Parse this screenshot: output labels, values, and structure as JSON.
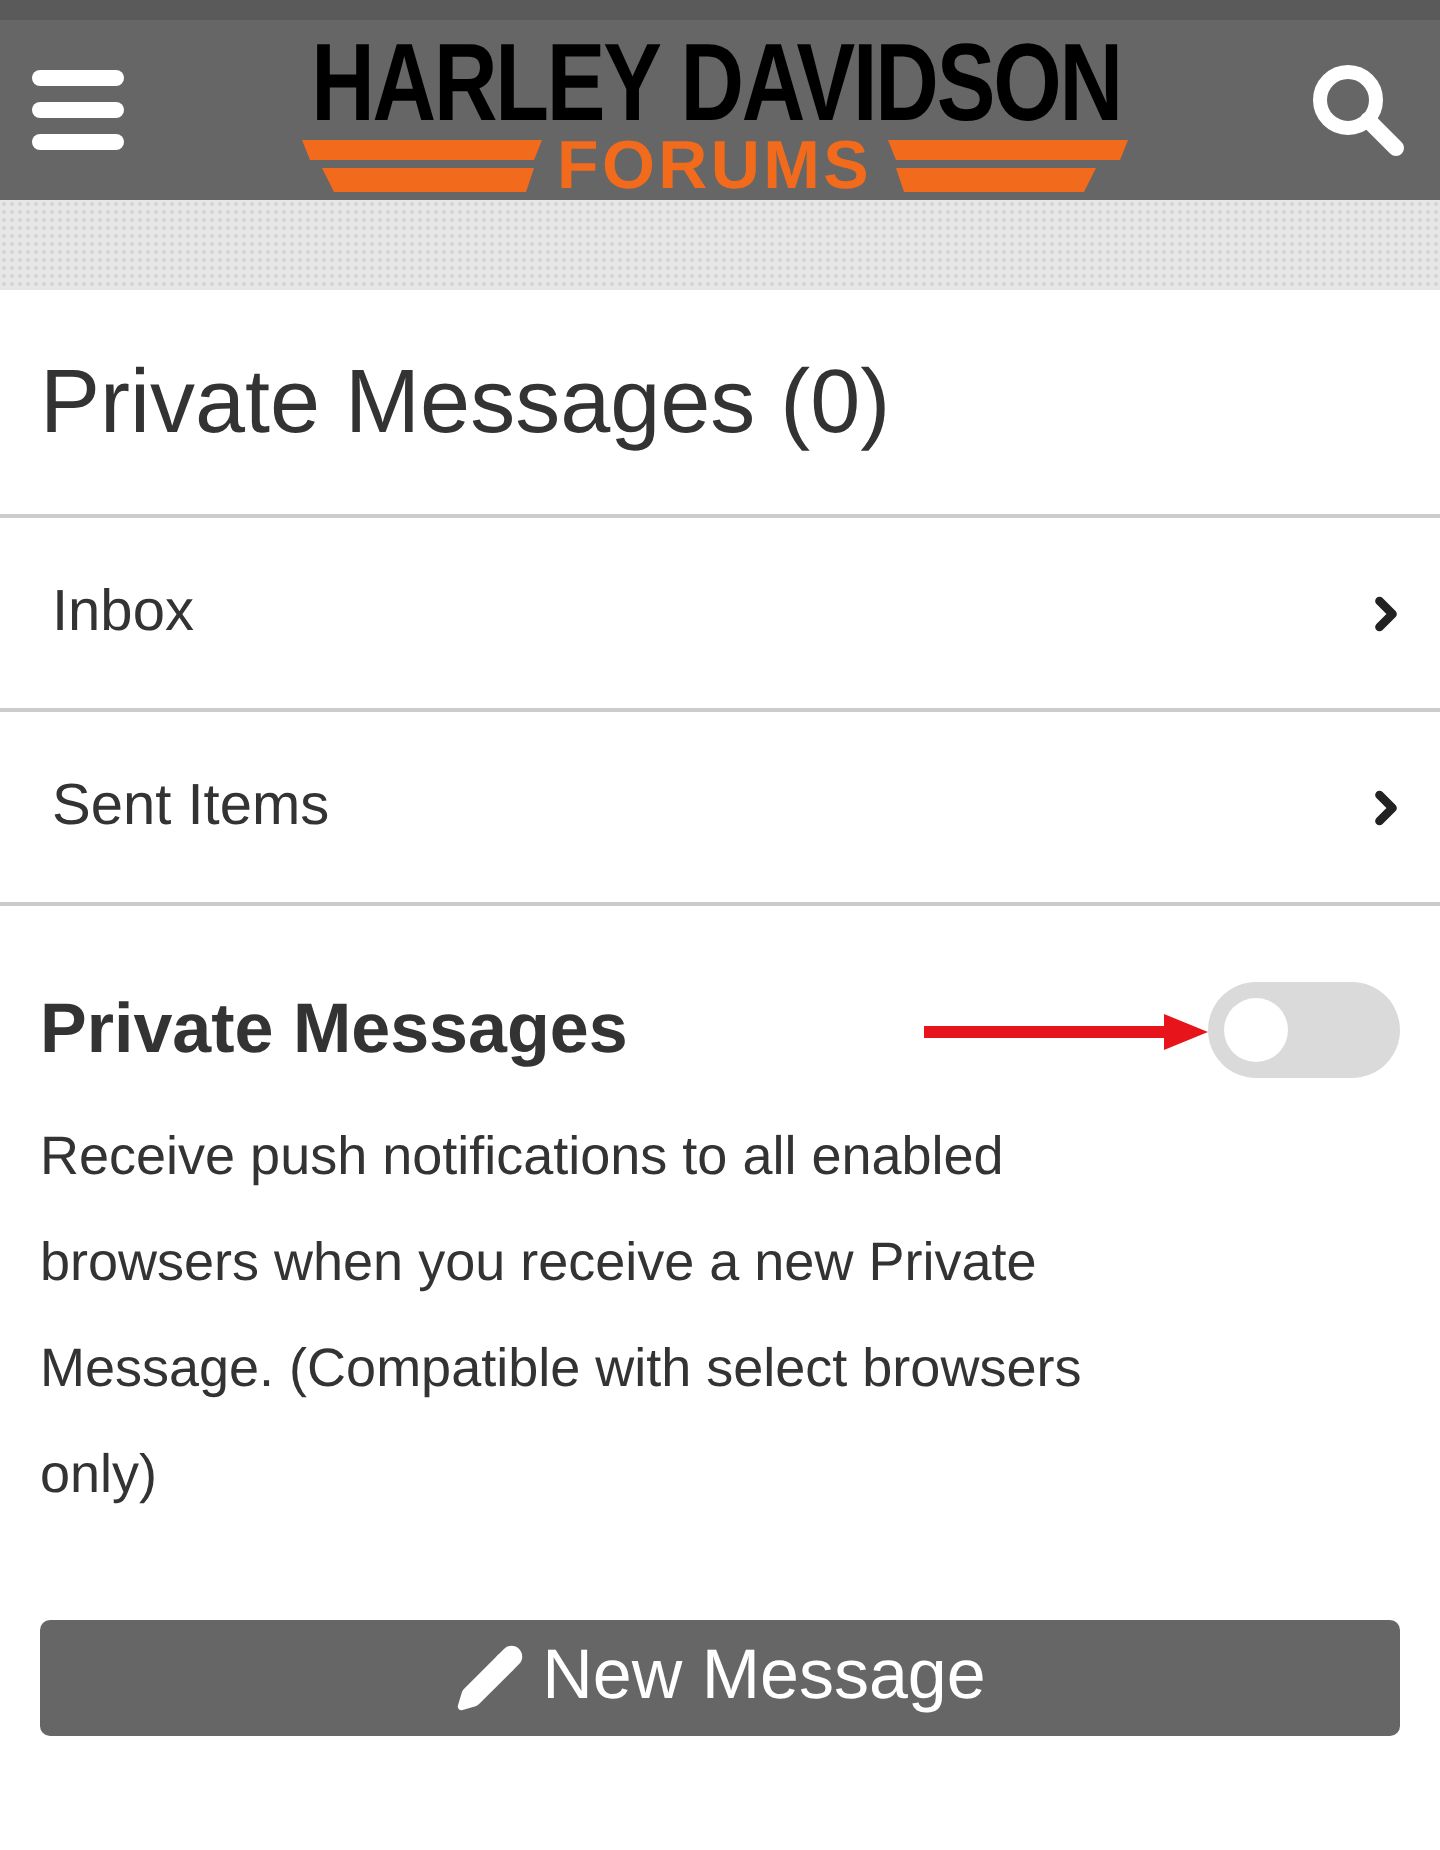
{
  "header": {
    "logo": {
      "title": "HARLEY DAVIDSON",
      "subtitle": "FORUMS"
    }
  },
  "page_title": "Private Messages (0)",
  "nav_items": [
    {
      "label": "Inbox"
    },
    {
      "label": "Sent Items"
    }
  ],
  "notification_setting": {
    "title": "Private Messages",
    "on": false,
    "description": "Receive push notifications to all enabled browsers when you receive a new Private Message. (Compatible with select browsers only)"
  },
  "new_message_button": "New Message"
}
